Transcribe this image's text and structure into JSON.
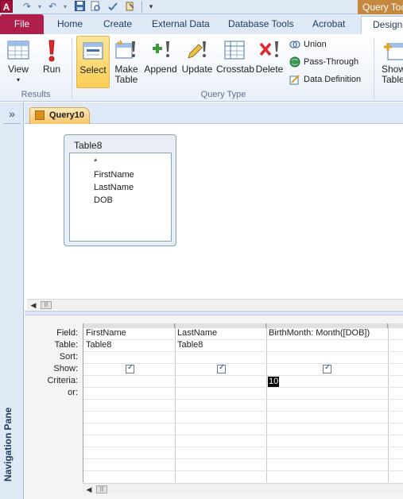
{
  "app": {
    "icon_letter": "A",
    "contextual_title": "Query Tools"
  },
  "tabs": {
    "file": "File",
    "home": "Home",
    "create": "Create",
    "external_data": "External Data",
    "database_tools": "Database Tools",
    "acrobat": "Acrobat",
    "design": "Design"
  },
  "ribbon": {
    "results": {
      "group_label": "Results",
      "view": "View",
      "run": "Run"
    },
    "query_type": {
      "group_label": "Query Type",
      "select": "Select",
      "make_table_line1": "Make",
      "make_table_line2": "Table",
      "append": "Append",
      "update": "Update",
      "crosstab": "Crosstab",
      "delete": "Delete",
      "union": "Union",
      "pass_through": "Pass-Through",
      "data_definition": "Data Definition"
    },
    "show_table_line1": "Show",
    "show_table_line2": "Table"
  },
  "nav": {
    "toggle": "»",
    "label": "Navigation Pane"
  },
  "document": {
    "tab_title": "Query10"
  },
  "table_card": {
    "title": "Table8",
    "fields": [
      "*",
      "FirstName",
      "LastName",
      "DOB"
    ]
  },
  "grid": {
    "row_labels": {
      "field": "Field:",
      "table": "Table:",
      "sort": "Sort:",
      "show": "Show:",
      "criteria": "Criteria:",
      "or": "or:"
    },
    "columns": [
      {
        "field": "FirstName",
        "table": "Table8",
        "sort": "",
        "show": true,
        "criteria": ""
      },
      {
        "field": "LastName",
        "table": "Table8",
        "sort": "",
        "show": true,
        "criteria": ""
      },
      {
        "field": "BirthMonth: Month([DOB])",
        "table": "",
        "sort": "",
        "show": true,
        "criteria": "10"
      }
    ]
  },
  "colors": {
    "file_tab": "#b01e4c",
    "contextual_tab": "#c4893f",
    "selected_button": "#fbcf56",
    "ribbon_bg": "#dfe9f5"
  }
}
